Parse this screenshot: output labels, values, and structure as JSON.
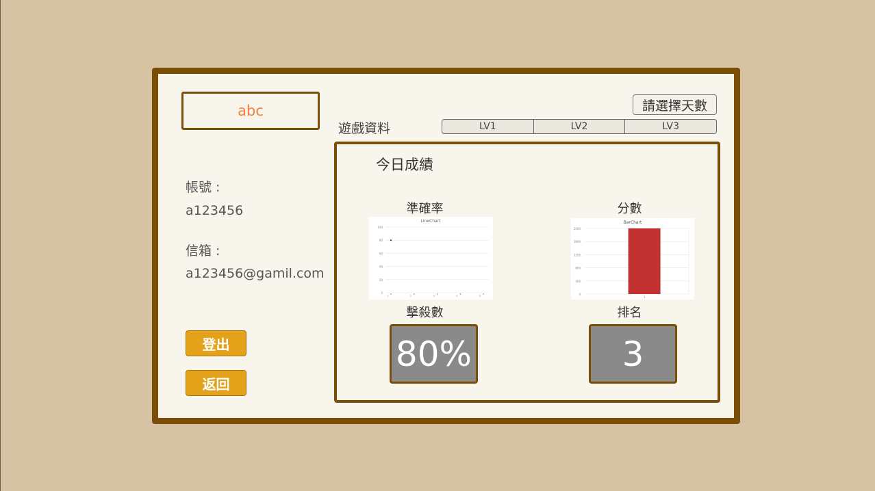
{
  "profile": {
    "name": "abc",
    "account_label": "帳號 :",
    "account_value": "a123456",
    "email_label": "信箱 :",
    "email_value": "a123456@gamil.com",
    "logout_label": "登出",
    "back_label": "返回"
  },
  "game": {
    "section_title": "遊戲資料",
    "days_button": "請選擇天數",
    "levels": [
      "LV1",
      "LV2",
      "LV3"
    ]
  },
  "today": {
    "title": "今日成績",
    "accuracy_label": "準確率",
    "score_label": "分數",
    "kills_label": "擊殺數",
    "kills_value": "80%",
    "rank_label": "排名",
    "rank_value": "3"
  },
  "chart_data": [
    {
      "type": "line",
      "title": "LineChart",
      "ylim": [
        0,
        100
      ],
      "x": [
        1,
        2,
        3,
        4,
        5
      ],
      "series": [
        {
          "values": [
            80,
            null,
            null,
            null,
            null
          ]
        }
      ],
      "color": "#222222"
    },
    {
      "type": "bar",
      "title": "BarChart",
      "ylim": [
        0,
        2000
      ],
      "categories": [
        "1"
      ],
      "values": [
        2000
      ],
      "color": "#c33232"
    }
  ]
}
